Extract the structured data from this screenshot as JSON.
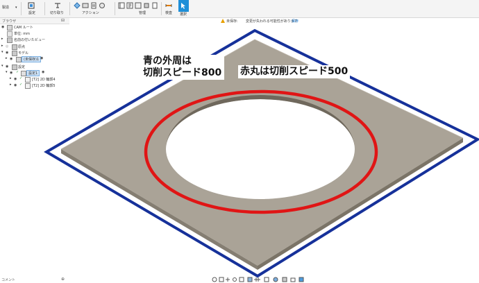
{
  "toolbar": {
    "workspace": "製造",
    "groups": [
      {
        "label": "設定",
        "icon": "setup-icon"
      },
      {
        "label": "切り取り",
        "icon": "cut-icon"
      },
      {
        "label": "アクション",
        "icon": "actions-icon"
      },
      {
        "label": "管理",
        "icon": "manage-icon"
      },
      {
        "label": "検査",
        "icon": "inspect-icon"
      },
      {
        "label": "選択",
        "icon": "select-icon"
      }
    ]
  },
  "browser": {
    "title": "ブラウザ",
    "items": [
      {
        "label": "CAM ルート"
      },
      {
        "label": "単位: mm"
      },
      {
        "label": "名前の付いたビュー"
      },
      {
        "label": "原点"
      },
      {
        "label": "モデル"
      },
      {
        "label": "(未保存)1"
      },
      {
        "label": "設定"
      },
      {
        "label": "設定1"
      },
      {
        "label": "[T2] 2D 輪郭4"
      },
      {
        "label": "[T2] 2D 輪郭5"
      }
    ]
  },
  "notice": {
    "status": "未保存:",
    "message": "変更が失われる可能性があります",
    "save": "保存"
  },
  "annotations": {
    "blue_line1": "青の外周は",
    "blue_line2": "切削スピード800",
    "red": "赤丸は切削スピード500"
  },
  "bottom": {
    "comments": "コメント"
  },
  "colors": {
    "blue_outline": "#16319a",
    "red_circle": "#e01515",
    "plate_top": "#aaa397",
    "plate_side": "#7b7467",
    "select_button": "#1e8fd8"
  }
}
